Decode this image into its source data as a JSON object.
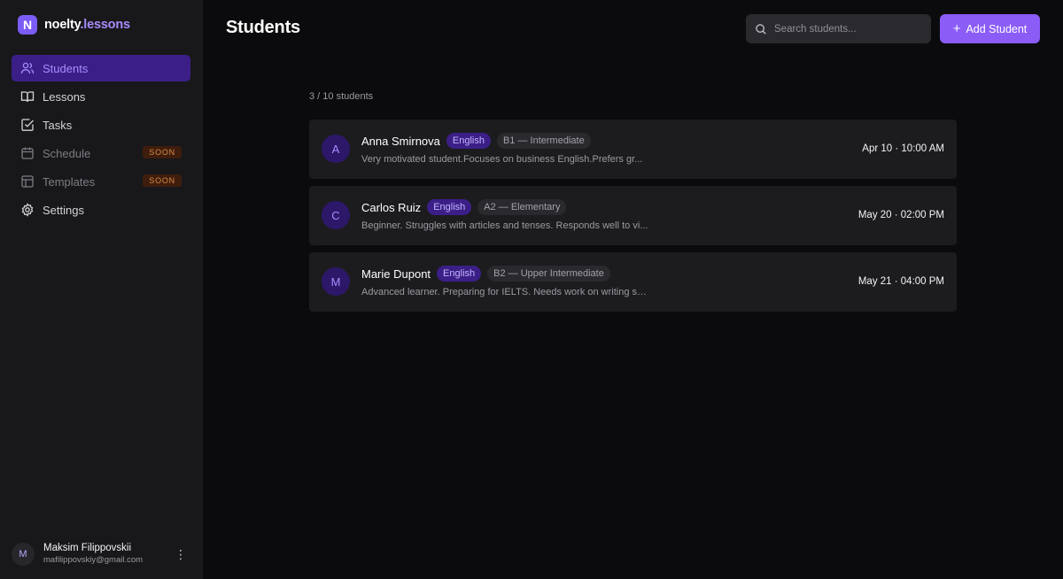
{
  "app": {
    "logo_letter": "N",
    "brand_part1": "noelty",
    "brand_part2": ".lessons"
  },
  "sidebar": {
    "items": [
      {
        "label": "Students",
        "icon": "users-icon",
        "active": true
      },
      {
        "label": "Lessons",
        "icon": "book-icon"
      },
      {
        "label": "Tasks",
        "icon": "checkbox-icon"
      },
      {
        "label": "Schedule",
        "icon": "calendar-icon",
        "badge": "SOON"
      },
      {
        "label": "Templates",
        "icon": "layout-icon",
        "badge": "SOON"
      },
      {
        "label": "Settings",
        "icon": "gear-icon"
      }
    ],
    "user": {
      "initial": "M",
      "name": "Maksim Filippovskii",
      "email": "mafilippovskiy@gmail.com"
    }
  },
  "header": {
    "title": "Students",
    "search_placeholder": "Search students...",
    "add_label": "Add Student"
  },
  "main": {
    "count": "3 / 10 students",
    "students": [
      {
        "initial": "A",
        "name": "Anna Smirnova",
        "language": "English",
        "level": "B1 — Intermediate",
        "note": "Very motivated student.Focuses on business English.Prefers gr...",
        "date": "Apr 10 · 10:00 AM"
      },
      {
        "initial": "C",
        "name": "Carlos Ruiz",
        "language": "English",
        "level": "A2 — Elementary",
        "note": "Beginner. Struggles with articles and tenses. Responds well to vi...",
        "date": "May 20 · 02:00 PM"
      },
      {
        "initial": "M",
        "name": "Marie Dupont",
        "language": "English",
        "level": "B2 — Upper Intermediate",
        "note": "Advanced learner. Preparing for IELTS. Needs work on writing str...",
        "date": "May 21 · 04:00 PM"
      }
    ]
  },
  "colors": {
    "accent": "#8b5cf6",
    "active_bg": "#3b1f87",
    "soon_text": "#d98a4a",
    "background": "#0b0b0d",
    "sidebar_bg": "#18181b"
  }
}
